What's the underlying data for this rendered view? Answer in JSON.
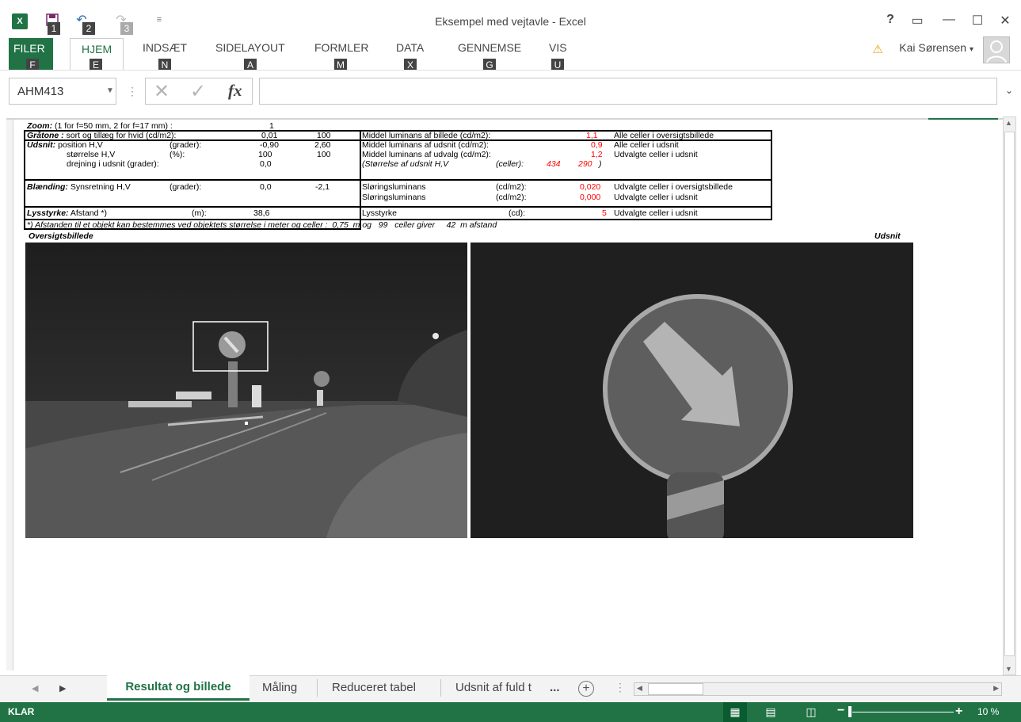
{
  "window": {
    "title": "Eksempel med vejtavle - Excel",
    "help": "?",
    "restore_ribbon": "▭",
    "minimize": "—",
    "maximize": "☐",
    "close": "✕"
  },
  "qat": {
    "app_logo": "X",
    "save_keytip": "1",
    "undo_keytip": "2",
    "redo_keytip": "3",
    "customize": "≡"
  },
  "ribbon": {
    "tabs": [
      {
        "label": "FILER",
        "keytip": "F"
      },
      {
        "label": "HJEM",
        "keytip": "E"
      },
      {
        "label": "INDSÆT",
        "keytip": "N"
      },
      {
        "label": "SIDELAYOUT",
        "keytip": "A"
      },
      {
        "label": "FORMLER",
        "keytip": "M"
      },
      {
        "label": "DATA",
        "keytip": "X"
      },
      {
        "label": "GENNEMSE",
        "keytip": "G"
      },
      {
        "label": "VIS",
        "keytip": "U"
      }
    ],
    "user_name": "Kai Sørensen"
  },
  "formula_bar": {
    "name_box": "AHM413",
    "formula": ""
  },
  "sheet": {
    "rows": {
      "r1": {
        "a": "Zoom:",
        "b": " (1 for f=50 mm, 2 for f=17 mm)  :",
        "v": "1"
      },
      "r2": {
        "a": "Gråtone :",
        "b": " sort og tillæg for hvid (cd/m2):",
        "v1": "0,01",
        "v2": "100",
        "c": "Middel luminans af billede (cd/m2):",
        "cv": "1,1",
        "d": "Alle celler i oversigtsbillede"
      },
      "r3": {
        "a": "Udsnit:",
        "b": " position H,V",
        "u": "(grader):",
        "v1": "-0,90",
        "v2": "2,60",
        "c": "Middel luminans af udsnit  (cd/m2):",
        "cv": "0,9",
        "d": "Alle celler i udsnit"
      },
      "r4": {
        "b": "størrelse H,V",
        "u": "(%):",
        "v1": "100",
        "v2": "100",
        "c": "Middel luminans af udvalg  (cd/m2):",
        "cv": "1,2",
        "d": "Udvalgte celler i udsnit"
      },
      "r5": {
        "b": "drejning i udsnit (grader):",
        "v1": "0,0",
        "c": "(Størrelse af udsnit H,V",
        "cu": "(celler):",
        "cv1": "434",
        "cv2": "290",
        "cclose": ")"
      },
      "r6": {
        "a": "Blænding:",
        "b": " Synsretning H,V",
        "u": "(grader):",
        "v1": "0,0",
        "v2": "-2,1",
        "c": "Sløringsluminans",
        "cu": "(cd/m2):",
        "cv": "0,020",
        "d": "Udvalgte celler i oversigtsbillede"
      },
      "r7": {
        "c": "Sløringsluminans",
        "cu": "(cd/m2):",
        "cv": "0,000",
        "d": "Udvalgte celler i udsnit"
      },
      "r8": {
        "a": "Lysstyrke:",
        "b": " Afstand *)",
        "u": "(m):",
        "v1": "38,6",
        "c": "Lysstyrke",
        "cu": "(cd):",
        "cv": "5",
        "d": "Udvalgte celler i udsnit"
      },
      "r9": {
        "note": "*) Afstanden til et objekt kan bestemmes ved objektets størrelse i meter og celler :",
        "n1": "0,75",
        "n1u": "m og",
        "n2": "99",
        "n2u": "celler giver",
        "n3": "42",
        "n3u": "m afstand"
      }
    },
    "caption_left": "Oversigtsbillede",
    "caption_right": "Udsnit"
  },
  "sheet_tabs": {
    "items": [
      "Resultat og billede",
      "Måling",
      "Reduceret tabel",
      "Udsnit af fuld t"
    ],
    "active_index": 0,
    "overflow": "...",
    "add": "+"
  },
  "status": {
    "text": "KLAR",
    "zoom": "10 %"
  },
  "colors": {
    "accent": "#217346",
    "status_bar": "#217346",
    "red_values": "#ff0000"
  },
  "icons": [
    "excel-logo-icon",
    "save-icon",
    "undo-icon",
    "redo-icon",
    "customize-qat-icon",
    "help-icon",
    "ribbon-display-icon",
    "minimize-icon",
    "maximize-icon",
    "close-icon",
    "warning-icon",
    "avatar-icon",
    "dropdown-icon",
    "cancel-icon",
    "enter-icon",
    "fx-icon",
    "expand-formula-icon",
    "normal-view-icon",
    "page-layout-icon",
    "page-break-icon",
    "add-sheet-icon"
  ]
}
